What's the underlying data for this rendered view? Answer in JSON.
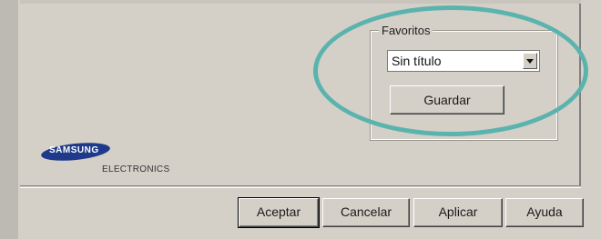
{
  "favorites": {
    "group_label": "Favoritos",
    "selected_value": "Sin título",
    "save_button": "Guardar"
  },
  "logo": {
    "brand": "SAMSUNG",
    "subtitle": "ELECTRONICS"
  },
  "dialog_buttons": {
    "accept": "Aceptar",
    "cancel": "Cancelar",
    "apply": "Aplicar",
    "help": "Ayuda"
  },
  "colors": {
    "highlight_ellipse": "#5bb3ad",
    "dialog_background": "#d4d0c8"
  },
  "icons": {
    "dropdown": "chevron-down-icon"
  }
}
